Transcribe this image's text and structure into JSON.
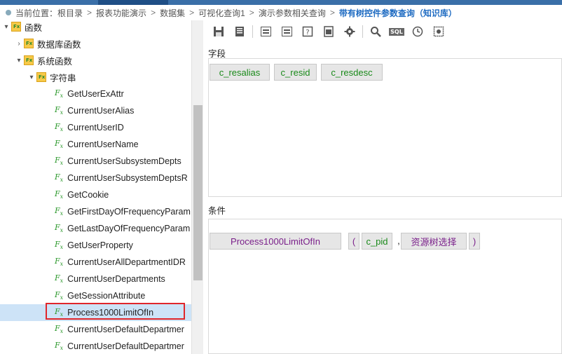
{
  "breadcrumb": {
    "items": [
      "当前位置：",
      "根目录",
      "报表功能演示",
      "数据集",
      "可视化查询1",
      "演示参数相关查询",
      "带有树控件参数查询（知识库）"
    ],
    "separator": ">"
  },
  "tree": {
    "root": {
      "label": "函数",
      "toggle": "▾"
    },
    "db_functions": {
      "label": "数据库函数",
      "toggle": "›"
    },
    "sys_functions": {
      "label": "系统函数",
      "toggle": "▾"
    },
    "string_folder": {
      "label": "字符串",
      "toggle": "▾"
    },
    "fx_icon": "F",
    "fx_sub": "x",
    "functions": [
      "GetUserExAttr",
      "CurrentUserAlias",
      "CurrentUserID",
      "CurrentUserName",
      "CurrentUserSubsystemDepts",
      "CurrentUserSubsystemDeptsR",
      "GetCookie",
      "GetFirstDayOfFrequencyParam",
      "GetLastDayOfFrequencyParam",
      "GetUserProperty",
      "CurrentUserAllDepartmentIDR",
      "CurrentUserDepartments",
      "GetSessionAttribute",
      "Process1000LimitOfIn",
      "CurrentUserDefaultDepartmer",
      "CurrentUserDefaultDepartmer"
    ],
    "selected_index": 13
  },
  "toolbar": {
    "icons": [
      "save-icon",
      "save-as-icon",
      "table-icon",
      "form-icon",
      "help-icon",
      "export-icon",
      "settings-icon",
      "search-icon",
      "sql-icon",
      "clock-icon",
      "config-icon"
    ],
    "sql_text": "SQL"
  },
  "fields": {
    "label": "字段",
    "chips": [
      "c_resalias",
      "c_resid",
      "c_resdesc"
    ]
  },
  "conditions": {
    "label": "条件",
    "function": "Process1000LimitOfIn",
    "open_paren": "(",
    "param": "c_pid",
    "comma": ",",
    "tree_param": "资源树选择",
    "close_paren": ")"
  },
  "colors": {
    "topbar": "#3a6fa8",
    "breadcrumb_current": "#1e6bc2",
    "field_text": "#1a8a1a",
    "function_text": "#7a1f8a",
    "selection": "#cde3f7",
    "highlight": "#e0262b"
  }
}
